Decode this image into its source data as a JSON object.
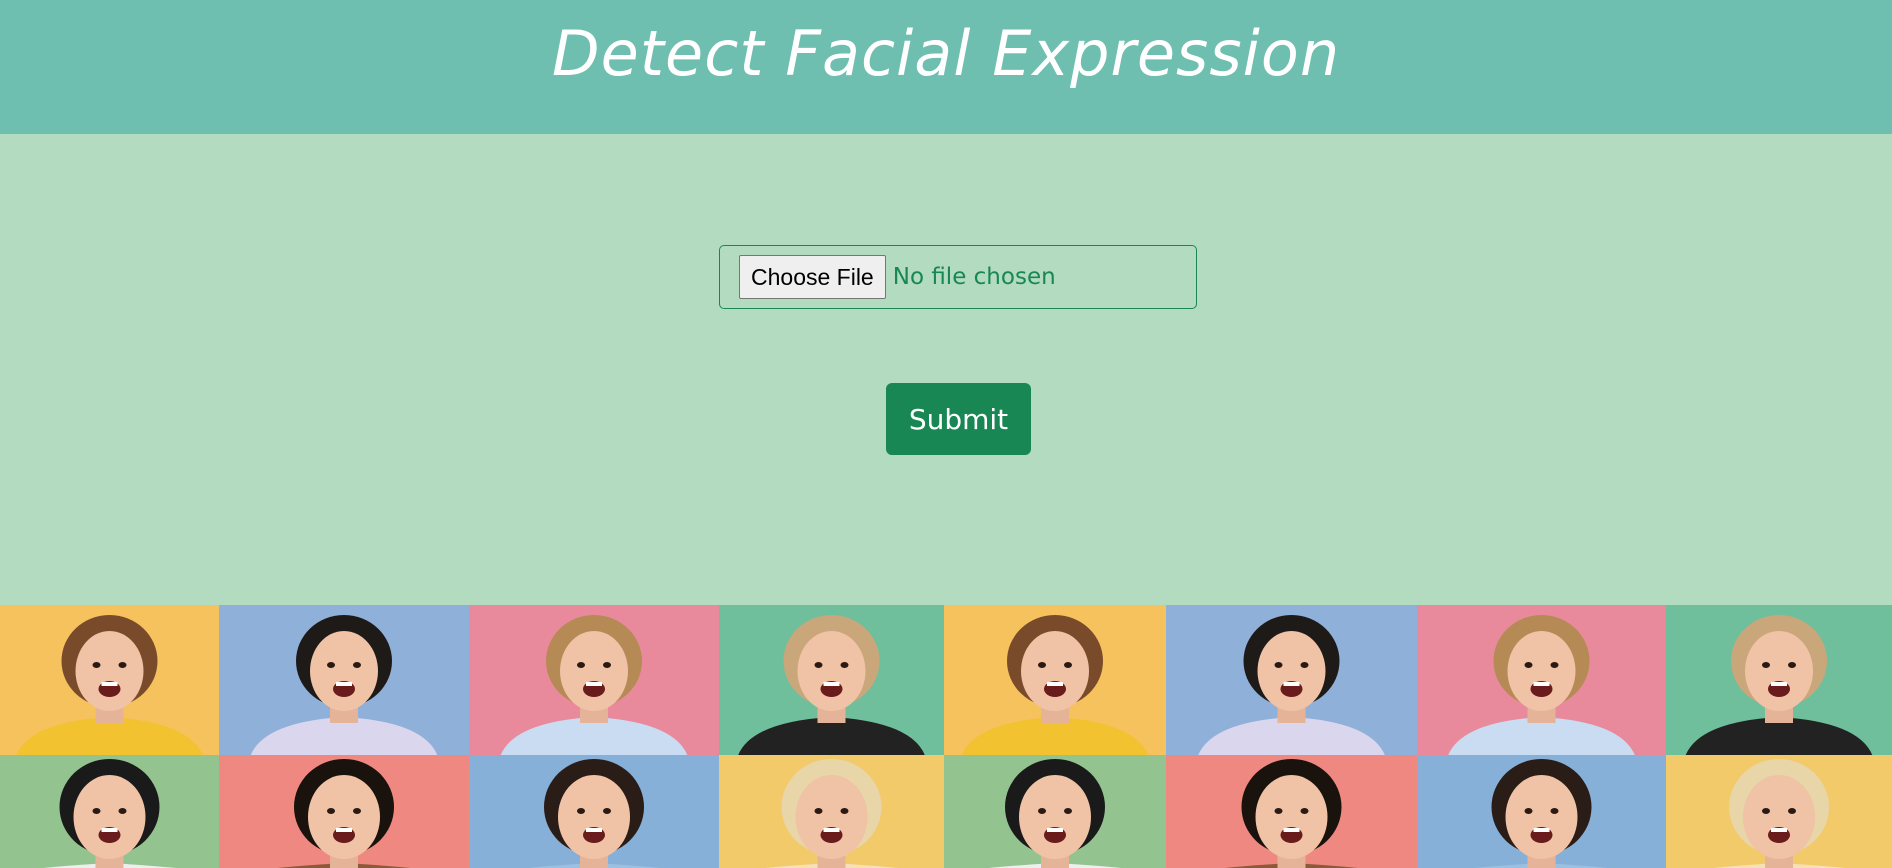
{
  "header": {
    "title": "Detect Facial Expression"
  },
  "form": {
    "choose_file_label": "Choose File",
    "file_status": "No file chosen",
    "submit_label": "Submit"
  },
  "colors": {
    "header_bg": "#6fbfb0",
    "page_bg": "#b2dbbf",
    "accent": "#198754"
  },
  "photo_collage": {
    "tiles": [
      {
        "bg": "#f6c25e",
        "shirt": "#f2c230",
        "hair": "#7a4b2a",
        "name": "woman-yellow-sweater"
      },
      {
        "bg": "#8fb0d8",
        "shirt": "#d9d6ee",
        "hair": "#1e1a18",
        "name": "man-hands-on-ears"
      },
      {
        "bg": "#e98a9c",
        "shirt": "#c9dcf2",
        "hair": "#b58a55",
        "name": "woman-winking"
      },
      {
        "bg": "#6fbf9c",
        "shirt": "#222222",
        "hair": "#c9a77a",
        "name": "man-shouting"
      },
      {
        "bg": "#f6c25e",
        "shirt": "#f2c230",
        "hair": "#7a4b2a",
        "name": "woman-yellow-sweater"
      },
      {
        "bg": "#8fb0d8",
        "shirt": "#d9d6ee",
        "hair": "#1e1a18",
        "name": "man-hands-on-ears"
      },
      {
        "bg": "#e98a9c",
        "shirt": "#c9dcf2",
        "hair": "#b58a55",
        "name": "woman-winking"
      },
      {
        "bg": "#6fbf9c",
        "shirt": "#222222",
        "hair": "#c9a77a",
        "name": "man-shouting"
      },
      {
        "bg": "#93c490",
        "shirt": "#eeeeee",
        "hair": "#1a1a1a",
        "name": "man-glasses"
      },
      {
        "bg": "#ee8880",
        "shirt": "#8a5a3a",
        "hair": "#1a120c",
        "name": "woman-curly-hair"
      },
      {
        "bg": "#86b0d8",
        "shirt": "#9cc0e0",
        "hair": "#2a1c16",
        "name": "man-covering-ears"
      },
      {
        "bg": "#f2ca6a",
        "shirt": "#f5e0b8",
        "hair": "#e8d5a8",
        "name": "woman-blonde"
      },
      {
        "bg": "#93c490",
        "shirt": "#eeeeee",
        "hair": "#1a1a1a",
        "name": "man-glasses"
      },
      {
        "bg": "#ee8880",
        "shirt": "#8a5a3a",
        "hair": "#1a120c",
        "name": "woman-curly-hair"
      },
      {
        "bg": "#86b0d8",
        "shirt": "#9cc0e0",
        "hair": "#2a1c16",
        "name": "man-covering-ears"
      },
      {
        "bg": "#f2ca6a",
        "shirt": "#f5e0b8",
        "hair": "#e8d5a8",
        "name": "woman-blonde"
      }
    ]
  }
}
